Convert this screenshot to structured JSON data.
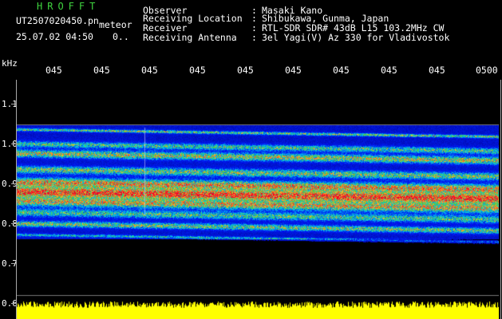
{
  "header": {
    "app_title": "HROFFT",
    "file_name": "UT2507020450.pn",
    "mode_label": "meteor",
    "datetime": "25.07.02 04:50",
    "ellipsis": "0..",
    "info": [
      {
        "key": "Observer",
        "value": "Masaki Kano"
      },
      {
        "key": "Receiving Location",
        "value": "Shibukawa, Gunma, Japan"
      },
      {
        "key": "Receiver",
        "value": "RTL-SDR SDR# 43dB L15 103.2MHz CW"
      },
      {
        "key": "Receiving Antenna",
        "value": "3el Yagi(V) Az 330 for Vladivostok"
      }
    ]
  },
  "axes": {
    "y_unit": "kHz",
    "y_ticks": [
      "1.1",
      "1.0",
      "0.9",
      "0.8",
      "0.7",
      "0.6"
    ],
    "x_ticks": [
      "045",
      "045",
      "045",
      "045",
      "045",
      "045",
      "045",
      "045",
      "045",
      "0500"
    ]
  },
  "colors": {
    "background": "#000000",
    "title_green": "#3fd43f",
    "signal_level": "#ffff00"
  }
}
